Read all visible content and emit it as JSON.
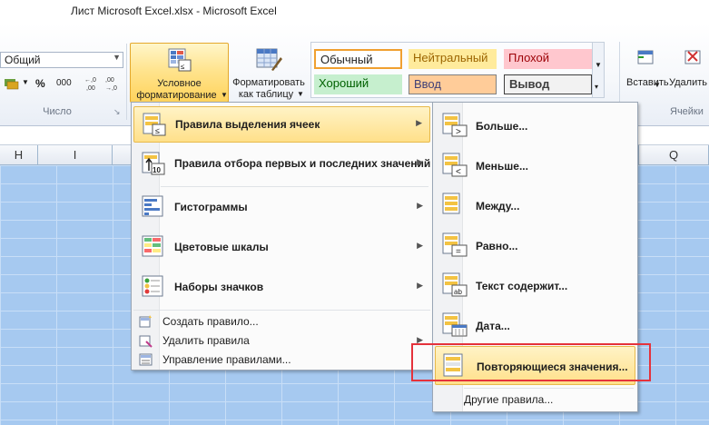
{
  "window": {
    "title": "Лист Microsoft Excel.xlsx  -  Microsoft Excel"
  },
  "ribbon": {
    "number_format": {
      "value": "Общий"
    },
    "number_buttons": {
      "percent": "%",
      "thousands": "000",
      "inc_decimal": "←,0\n,00",
      "dec_decimal": ",00\n→,0"
    },
    "number_group_label": "Число",
    "conditional_formatting": {
      "line1": "Условное",
      "line2": "форматирование"
    },
    "format_as_table": {
      "line1": "Форматировать",
      "line2": "как таблицу"
    },
    "styles": {
      "row1": [
        "Обычный",
        "Нейтральный",
        "Плохой"
      ],
      "row2": [
        "Хороший",
        "Ввод",
        "Вывод"
      ]
    },
    "insert_label": "Вставить",
    "delete_label": "Удалить",
    "cells_group_label": "Ячейки"
  },
  "columns": {
    "left": "H",
    "i": "I",
    "q": "Q"
  },
  "cf_menu": {
    "items": [
      {
        "label": "Правила выделения ячеек"
      },
      {
        "label": "Правила отбора первых и последних значений"
      },
      {
        "label": "Гистограммы"
      },
      {
        "label": "Цветовые шкалы"
      },
      {
        "label": "Наборы значков"
      }
    ],
    "small_items": [
      {
        "label": "Создать правило..."
      },
      {
        "label": "Удалить правила"
      },
      {
        "label": "Управление правилами..."
      }
    ]
  },
  "sub_menu": {
    "items": [
      {
        "label": "Больше..."
      },
      {
        "label": "Меньше..."
      },
      {
        "label": "Между..."
      },
      {
        "label": "Равно..."
      },
      {
        "label": "Текст содержит..."
      },
      {
        "label": "Дата..."
      },
      {
        "label": "Повторяющиеся значения..."
      }
    ],
    "other": "Другие правила..."
  },
  "colors": {
    "highlight": "#e5323b",
    "hover_bg": "#ffe08a",
    "grid": "#a6c9f0"
  }
}
